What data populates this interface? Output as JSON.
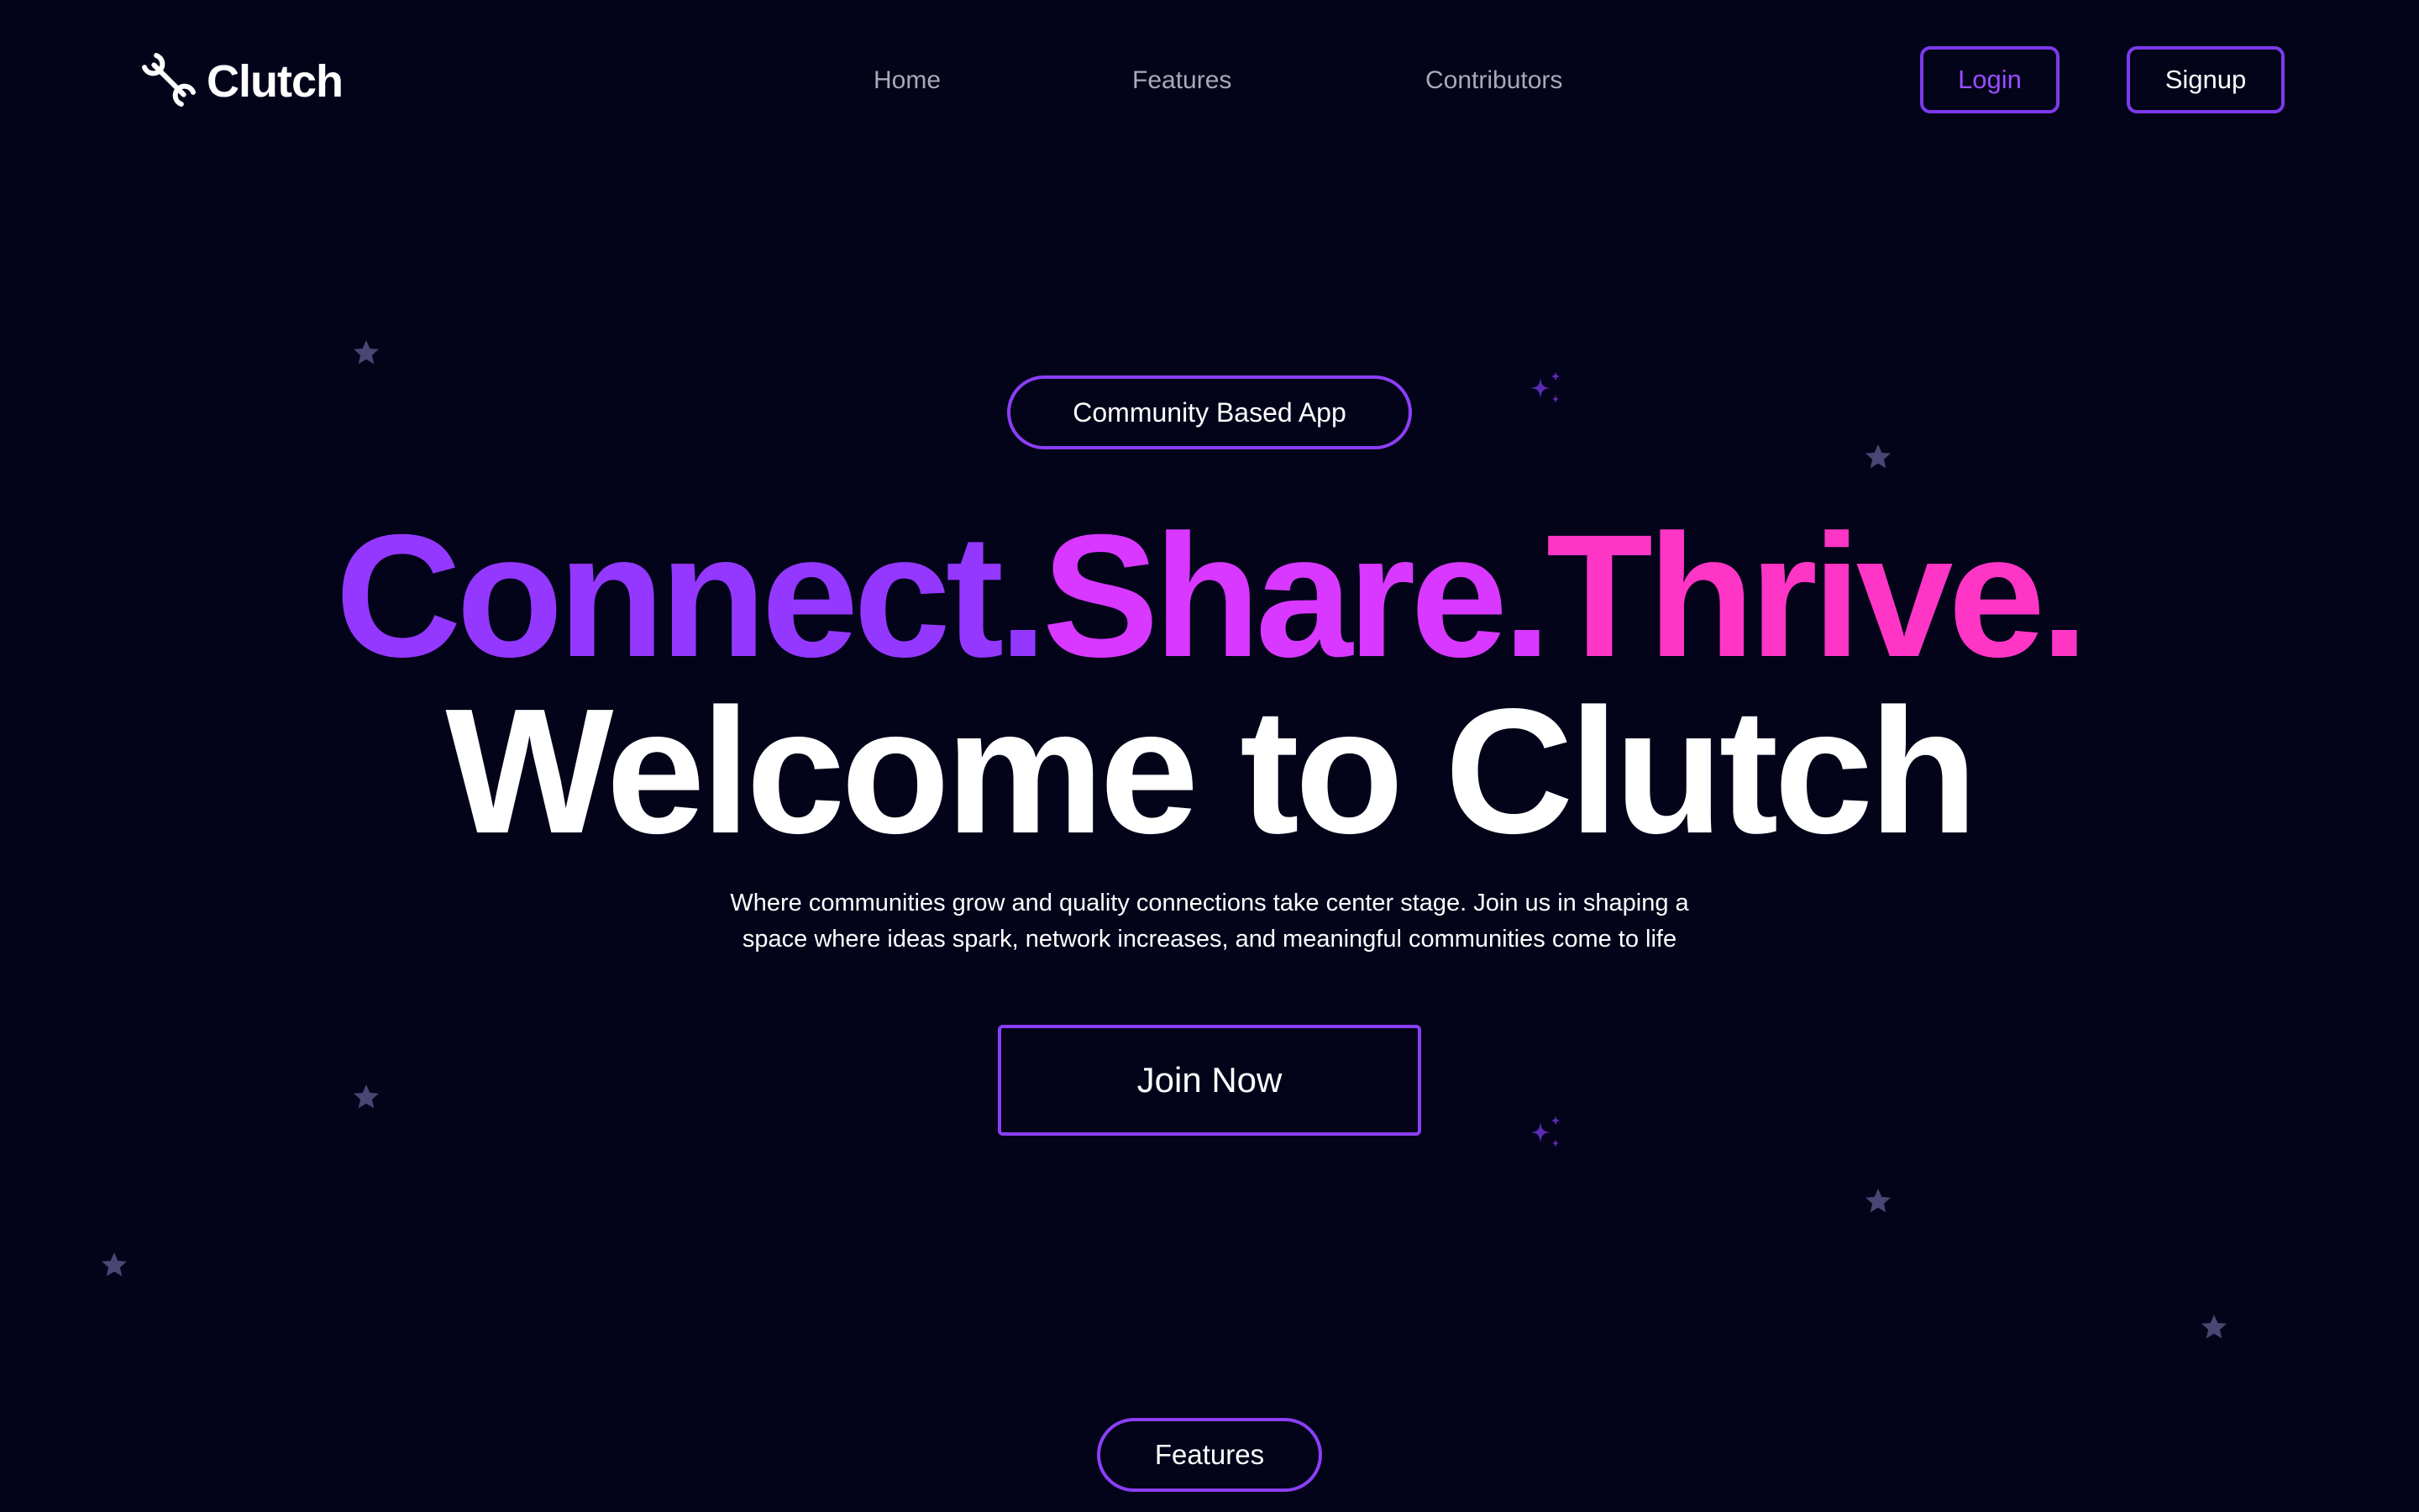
{
  "nav": {
    "logo_text": "Clutch",
    "logo_icon": "wrench-icon",
    "links": [
      {
        "label": "Home"
      },
      {
        "label": "Features"
      },
      {
        "label": "Contributors"
      }
    ],
    "login_label": "Login",
    "signup_label": "Signup"
  },
  "hero": {
    "badge": "Community Based App",
    "headline_parts": [
      "Connect.",
      "Share.",
      "Thrive."
    ],
    "headline_2": "Welcome to Clutch",
    "subtitle_line_1": "Where communities grow and quality connections take center stage. Join us in shaping a",
    "subtitle_line_2": "space where ideas spark, network increases, and meaningful communities come to life",
    "cta_label": "Join Now"
  },
  "next_section": {
    "label": "Features"
  },
  "decorations": {
    "star_icon": "star-icon",
    "sparkle_icon": "sparkle-icon"
  },
  "colors": {
    "background": "#03031a",
    "accent": "#8b3ff5",
    "connect": "#9438ff",
    "share": "#d838ff",
    "thrive": "#ff35c6",
    "nav_text": "#a9a9b8",
    "star": "#4a4572",
    "sparkle": "#5b2bb5"
  }
}
